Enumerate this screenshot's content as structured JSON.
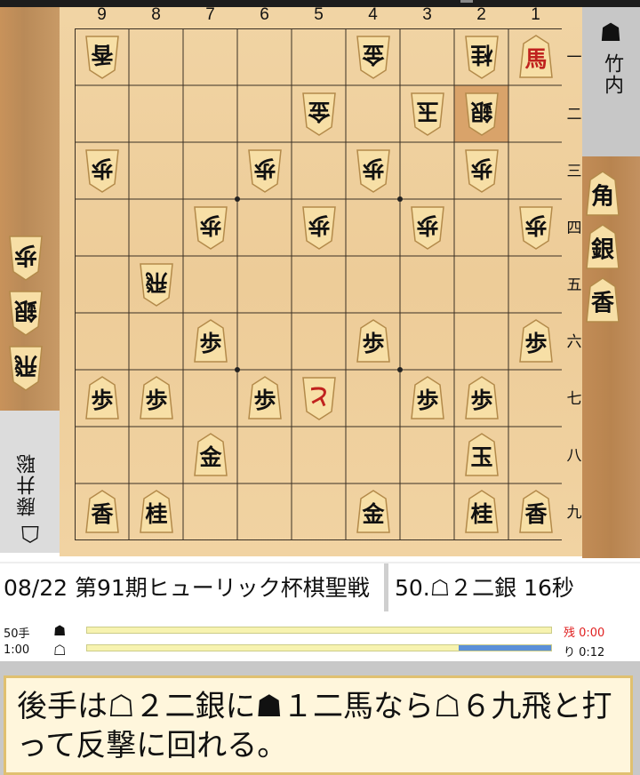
{
  "column_labels": [
    "9",
    "8",
    "7",
    "6",
    "5",
    "4",
    "3",
    "2",
    "1"
  ],
  "row_labels": [
    "一",
    "二",
    "三",
    "四",
    "五",
    "六",
    "七",
    "八",
    "九"
  ],
  "board": {
    "pieces": [
      {
        "file": 9,
        "rank": 1,
        "kanji": "香",
        "owner": "gote",
        "promoted": false
      },
      {
        "file": 4,
        "rank": 1,
        "kanji": "金",
        "owner": "gote",
        "promoted": false
      },
      {
        "file": 2,
        "rank": 1,
        "kanji": "桂",
        "owner": "gote",
        "promoted": false
      },
      {
        "file": 1,
        "rank": 1,
        "kanji": "馬",
        "owner": "sente",
        "promoted": true
      },
      {
        "file": 5,
        "rank": 2,
        "kanji": "金",
        "owner": "gote",
        "promoted": false
      },
      {
        "file": 3,
        "rank": 2,
        "kanji": "玉",
        "owner": "gote",
        "promoted": false
      },
      {
        "file": 2,
        "rank": 2,
        "kanji": "銀",
        "owner": "gote",
        "promoted": false
      },
      {
        "file": 9,
        "rank": 3,
        "kanji": "歩",
        "owner": "gote",
        "promoted": false
      },
      {
        "file": 6,
        "rank": 3,
        "kanji": "歩",
        "owner": "gote",
        "promoted": false
      },
      {
        "file": 4,
        "rank": 3,
        "kanji": "歩",
        "owner": "gote",
        "promoted": false
      },
      {
        "file": 2,
        "rank": 3,
        "kanji": "歩",
        "owner": "gote",
        "promoted": false
      },
      {
        "file": 7,
        "rank": 4,
        "kanji": "歩",
        "owner": "gote",
        "promoted": false
      },
      {
        "file": 5,
        "rank": 4,
        "kanji": "歩",
        "owner": "gote",
        "promoted": false
      },
      {
        "file": 3,
        "rank": 4,
        "kanji": "歩",
        "owner": "gote",
        "promoted": false
      },
      {
        "file": 1,
        "rank": 4,
        "kanji": "歩",
        "owner": "gote",
        "promoted": false
      },
      {
        "file": 8,
        "rank": 5,
        "kanji": "飛",
        "owner": "gote",
        "promoted": false
      },
      {
        "file": 7,
        "rank": 6,
        "kanji": "歩",
        "owner": "sente",
        "promoted": false
      },
      {
        "file": 4,
        "rank": 6,
        "kanji": "歩",
        "owner": "sente",
        "promoted": false
      },
      {
        "file": 1,
        "rank": 6,
        "kanji": "歩",
        "owner": "sente",
        "promoted": false
      },
      {
        "file": 9,
        "rank": 7,
        "kanji": "歩",
        "owner": "sente",
        "promoted": false
      },
      {
        "file": 8,
        "rank": 7,
        "kanji": "歩",
        "owner": "sente",
        "promoted": false
      },
      {
        "file": 6,
        "rank": 7,
        "kanji": "歩",
        "owner": "sente",
        "promoted": false
      },
      {
        "file": 5,
        "rank": 7,
        "kanji": "と",
        "owner": "gote",
        "promoted": true
      },
      {
        "file": 3,
        "rank": 7,
        "kanji": "歩",
        "owner": "sente",
        "promoted": false
      },
      {
        "file": 2,
        "rank": 7,
        "kanji": "歩",
        "owner": "sente",
        "promoted": false
      },
      {
        "file": 7,
        "rank": 8,
        "kanji": "金",
        "owner": "sente",
        "promoted": false
      },
      {
        "file": 2,
        "rank": 8,
        "kanji": "玉",
        "owner": "sente",
        "promoted": false
      },
      {
        "file": 9,
        "rank": 9,
        "kanji": "香",
        "owner": "sente",
        "promoted": false
      },
      {
        "file": 8,
        "rank": 9,
        "kanji": "桂",
        "owner": "sente",
        "promoted": false
      },
      {
        "file": 4,
        "rank": 9,
        "kanji": "金",
        "owner": "sente",
        "promoted": false
      },
      {
        "file": 2,
        "rank": 9,
        "kanji": "桂",
        "owner": "sente",
        "promoted": false
      },
      {
        "file": 1,
        "rank": 9,
        "kanji": "香",
        "owner": "sente",
        "promoted": false
      }
    ],
    "last_move_square": {
      "file": 2,
      "rank": 2
    }
  },
  "sente_player": {
    "mark": "☗",
    "name": "竹内",
    "hand": [
      "角",
      "銀",
      "香"
    ]
  },
  "gote_player": {
    "mark": "☖",
    "name": "藤井聡",
    "hand": [
      "歩",
      "銀",
      "飛"
    ]
  },
  "event_title": "08/22 第91期ヒューリック杯棋聖戦",
  "current_move": "50.☖２二銀 16秒",
  "clock": {
    "move_label": "50手",
    "time_label": "1:00",
    "sente_mark": "☗",
    "gote_mark": "☖",
    "sente_remaining_text": "残 0:00",
    "gote_remaining_text": "り 0:12",
    "sente_remaining_fraction": 0.0,
    "gote_remaining_fraction": 0.2
  },
  "comment": "後手は☖２二銀に☗１二馬なら☖６九飛と打って反撃に回れる。",
  "colors": {
    "sente_piece_text": "#111111",
    "promoted_text": "#c0221e",
    "clock_red": "#e02020",
    "clock_fill": "#5a8fd8"
  }
}
